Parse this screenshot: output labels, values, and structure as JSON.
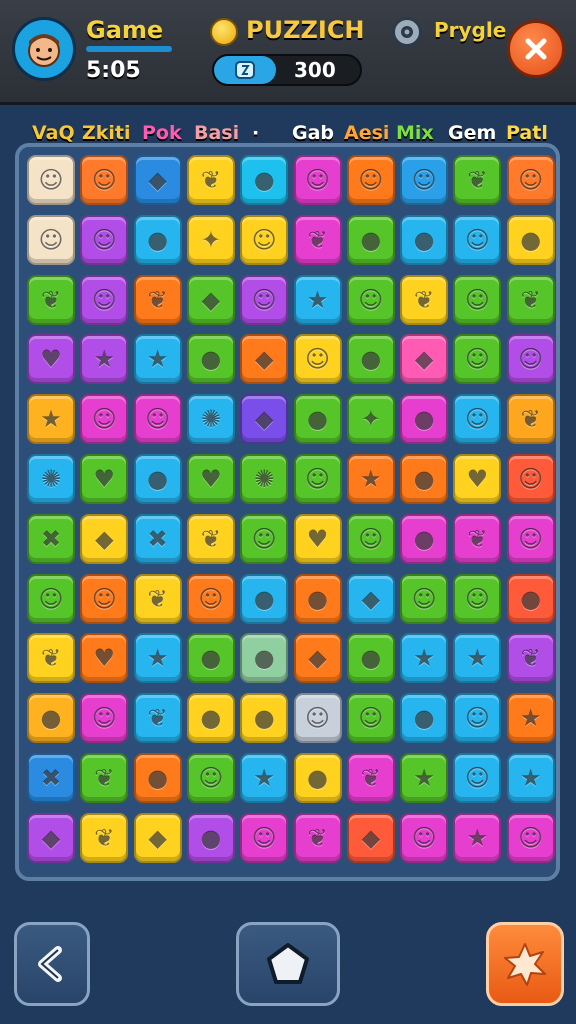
{
  "player": {
    "name": "Game",
    "time": "5:05"
  },
  "title": "PUZZICH",
  "score": {
    "value": "300"
  },
  "mode_label": "Prygle",
  "categories": [
    {
      "label": "VaQ",
      "color": "#f6c73a"
    },
    {
      "label": "Zkiti",
      "color": "#f6c73a"
    },
    {
      "label": "Pok",
      "color": "#ff5ab4"
    },
    {
      "label": "Basi",
      "color": "#f1a0a8"
    },
    {
      "label": "·",
      "color": "#ffffff"
    },
    {
      "label": "Gab",
      "color": "#ffffff"
    },
    {
      "label": "Aesi",
      "color": "#ffa63a"
    },
    {
      "label": "Mix",
      "color": "#7ee040"
    },
    {
      "label": "Gem",
      "color": "#ffffff"
    },
    {
      "label": "Patl",
      "color": "#ffd84a"
    }
  ],
  "board": {
    "columns": 10,
    "rows": [
      [
        {
          "c": "#f5e3c8",
          "i": "face"
        },
        {
          "c": "#ff7a2a",
          "i": "face"
        },
        {
          "c": "#2a8be0",
          "i": "gem"
        },
        {
          "c": "#ffd21f",
          "i": "leaf"
        },
        {
          "c": "#1ec0ee",
          "i": "drop"
        },
        {
          "c": "#e63fd0",
          "i": "face"
        },
        {
          "c": "#ff7a1a",
          "i": "face"
        },
        {
          "c": "#2aa0e8",
          "i": "face"
        },
        {
          "c": "#56c52a",
          "i": "leaf"
        },
        {
          "c": "#ff7a2a",
          "i": "face"
        }
      ],
      [
        {
          "c": "#f5e3c8",
          "i": "face"
        },
        {
          "c": "#b24ee8",
          "i": "face"
        },
        {
          "c": "#27b5f0",
          "i": "drop"
        },
        {
          "c": "#ffd21f",
          "i": "bird"
        },
        {
          "c": "#ffd21f",
          "i": "face"
        },
        {
          "c": "#e63fd0",
          "i": "leaf"
        },
        {
          "c": "#56c52a",
          "i": "drop"
        },
        {
          "c": "#27b5f0",
          "i": "drop"
        },
        {
          "c": "#27b5f0",
          "i": "face"
        },
        {
          "c": "#ffd21f",
          "i": "drop"
        }
      ],
      [
        {
          "c": "#56c52a",
          "i": "leaf"
        },
        {
          "c": "#b24ee8",
          "i": "face"
        },
        {
          "c": "#ff7a1a",
          "i": "leaf"
        },
        {
          "c": "#56c52a",
          "i": "gem"
        },
        {
          "c": "#b24ee8",
          "i": "face"
        },
        {
          "c": "#27b5f0",
          "i": "star"
        },
        {
          "c": "#56c52a",
          "i": "face"
        },
        {
          "c": "#ffd21f",
          "i": "leaf"
        },
        {
          "c": "#56c52a",
          "i": "face"
        },
        {
          "c": "#56c52a",
          "i": "leaf"
        }
      ],
      [
        {
          "c": "#b24ee8",
          "i": "heart"
        },
        {
          "c": "#b24ee8",
          "i": "star"
        },
        {
          "c": "#27b5f0",
          "i": "star"
        },
        {
          "c": "#56c52a",
          "i": "drop"
        },
        {
          "c": "#ff7a1a",
          "i": "gem"
        },
        {
          "c": "#ffd21f",
          "i": "face"
        },
        {
          "c": "#56c52a",
          "i": "drop"
        },
        {
          "c": "#ff5ab4",
          "i": "gem"
        },
        {
          "c": "#56c52a",
          "i": "face"
        },
        {
          "c": "#b24ee8",
          "i": "face"
        }
      ],
      [
        {
          "c": "#ffb21f",
          "i": "star"
        },
        {
          "c": "#e63fd0",
          "i": "face"
        },
        {
          "c": "#e63fd0",
          "i": "face"
        },
        {
          "c": "#27b5f0",
          "i": "swirl"
        },
        {
          "c": "#7a4ee8",
          "i": "gem"
        },
        {
          "c": "#56c52a",
          "i": "drop"
        },
        {
          "c": "#56c52a",
          "i": "bird"
        },
        {
          "c": "#e63fd0",
          "i": "drop"
        },
        {
          "c": "#27b5f0",
          "i": "face"
        },
        {
          "c": "#ffa61f",
          "i": "leaf"
        }
      ],
      [
        {
          "c": "#27b5f0",
          "i": "swirl"
        },
        {
          "c": "#56c52a",
          "i": "heart"
        },
        {
          "c": "#27b5f0",
          "i": "drop"
        },
        {
          "c": "#56c52a",
          "i": "heart"
        },
        {
          "c": "#56c52a",
          "i": "swirl"
        },
        {
          "c": "#56c52a",
          "i": "face"
        },
        {
          "c": "#ff7a1a",
          "i": "star"
        },
        {
          "c": "#ff7a1a",
          "i": "drop"
        },
        {
          "c": "#ffd21f",
          "i": "heart"
        },
        {
          "c": "#ff5a3a",
          "i": "face"
        }
      ],
      [
        {
          "c": "#56c52a",
          "i": "cross"
        },
        {
          "c": "#ffd21f",
          "i": "gem"
        },
        {
          "c": "#27b5f0",
          "i": "cross"
        },
        {
          "c": "#ffd21f",
          "i": "leaf"
        },
        {
          "c": "#56c52a",
          "i": "face"
        },
        {
          "c": "#ffd21f",
          "i": "heart"
        },
        {
          "c": "#56c52a",
          "i": "face"
        },
        {
          "c": "#e63fd0",
          "i": "drop"
        },
        {
          "c": "#e63fd0",
          "i": "leaf"
        },
        {
          "c": "#e63fd0",
          "i": "face"
        }
      ],
      [
        {
          "c": "#56c52a",
          "i": "face"
        },
        {
          "c": "#ff7a1a",
          "i": "face"
        },
        {
          "c": "#ffd21f",
          "i": "leaf"
        },
        {
          "c": "#ff7a1a",
          "i": "face"
        },
        {
          "c": "#27b5f0",
          "i": "drop"
        },
        {
          "c": "#ff7a1a",
          "i": "drop"
        },
        {
          "c": "#27b5f0",
          "i": "gem"
        },
        {
          "c": "#56c52a",
          "i": "face"
        },
        {
          "c": "#56c52a",
          "i": "face"
        },
        {
          "c": "#ff5a3a",
          "i": "drop"
        }
      ],
      [
        {
          "c": "#ffd21f",
          "i": "leaf"
        },
        {
          "c": "#ff7a1a",
          "i": "heart"
        },
        {
          "c": "#27b5f0",
          "i": "star"
        },
        {
          "c": "#56c52a",
          "i": "drop"
        },
        {
          "c": "#8fcfa0",
          "i": "drop"
        },
        {
          "c": "#ff7a1a",
          "i": "gem"
        },
        {
          "c": "#56c52a",
          "i": "drop"
        },
        {
          "c": "#27b5f0",
          "i": "star"
        },
        {
          "c": "#27b5f0",
          "i": "star"
        },
        {
          "c": "#b24ee8",
          "i": "leaf"
        }
      ],
      [
        {
          "c": "#ffb21f",
          "i": "drop"
        },
        {
          "c": "#e63fd0",
          "i": "face"
        },
        {
          "c": "#27b5f0",
          "i": "leaf"
        },
        {
          "c": "#ffd21f",
          "i": "drop"
        },
        {
          "c": "#ffd21f",
          "i": "drop"
        },
        {
          "c": "#c8d0dc",
          "i": "face"
        },
        {
          "c": "#56c52a",
          "i": "face"
        },
        {
          "c": "#27b5f0",
          "i": "drop"
        },
        {
          "c": "#27b5f0",
          "i": "face"
        },
        {
          "c": "#ff7a1a",
          "i": "star"
        }
      ],
      [
        {
          "c": "#2a8be0",
          "i": "cross"
        },
        {
          "c": "#56c52a",
          "i": "leaf"
        },
        {
          "c": "#ff7a1a",
          "i": "drop"
        },
        {
          "c": "#56c52a",
          "i": "face"
        },
        {
          "c": "#27b5f0",
          "i": "star"
        },
        {
          "c": "#ffd21f",
          "i": "drop"
        },
        {
          "c": "#e63fd0",
          "i": "leaf"
        },
        {
          "c": "#56c52a",
          "i": "star"
        },
        {
          "c": "#27b5f0",
          "i": "face"
        },
        {
          "c": "#27b5f0",
          "i": "star"
        }
      ],
      [
        {
          "c": "#b24ee8",
          "i": "gem"
        },
        {
          "c": "#ffd21f",
          "i": "leaf"
        },
        {
          "c": "#ffd21f",
          "i": "gem"
        },
        {
          "c": "#b24ee8",
          "i": "drop"
        },
        {
          "c": "#e63fd0",
          "i": "face"
        },
        {
          "c": "#e63fd0",
          "i": "leaf"
        },
        {
          "c": "#ff5a3a",
          "i": "gem"
        },
        {
          "c": "#e63fd0",
          "i": "face"
        },
        {
          "c": "#e63fd0",
          "i": "star"
        },
        {
          "c": "#e63fd0",
          "i": "face"
        }
      ]
    ]
  },
  "icons": {
    "face": "☺",
    "gem": "◆",
    "leaf": "❦",
    "drop": "●",
    "bird": "✦",
    "star": "★",
    "heart": "♥",
    "swirl": "✺",
    "cross": "✖"
  },
  "nav": [
    "back-arrow-icon",
    "home-pentagon-icon",
    "power-burst-icon"
  ]
}
